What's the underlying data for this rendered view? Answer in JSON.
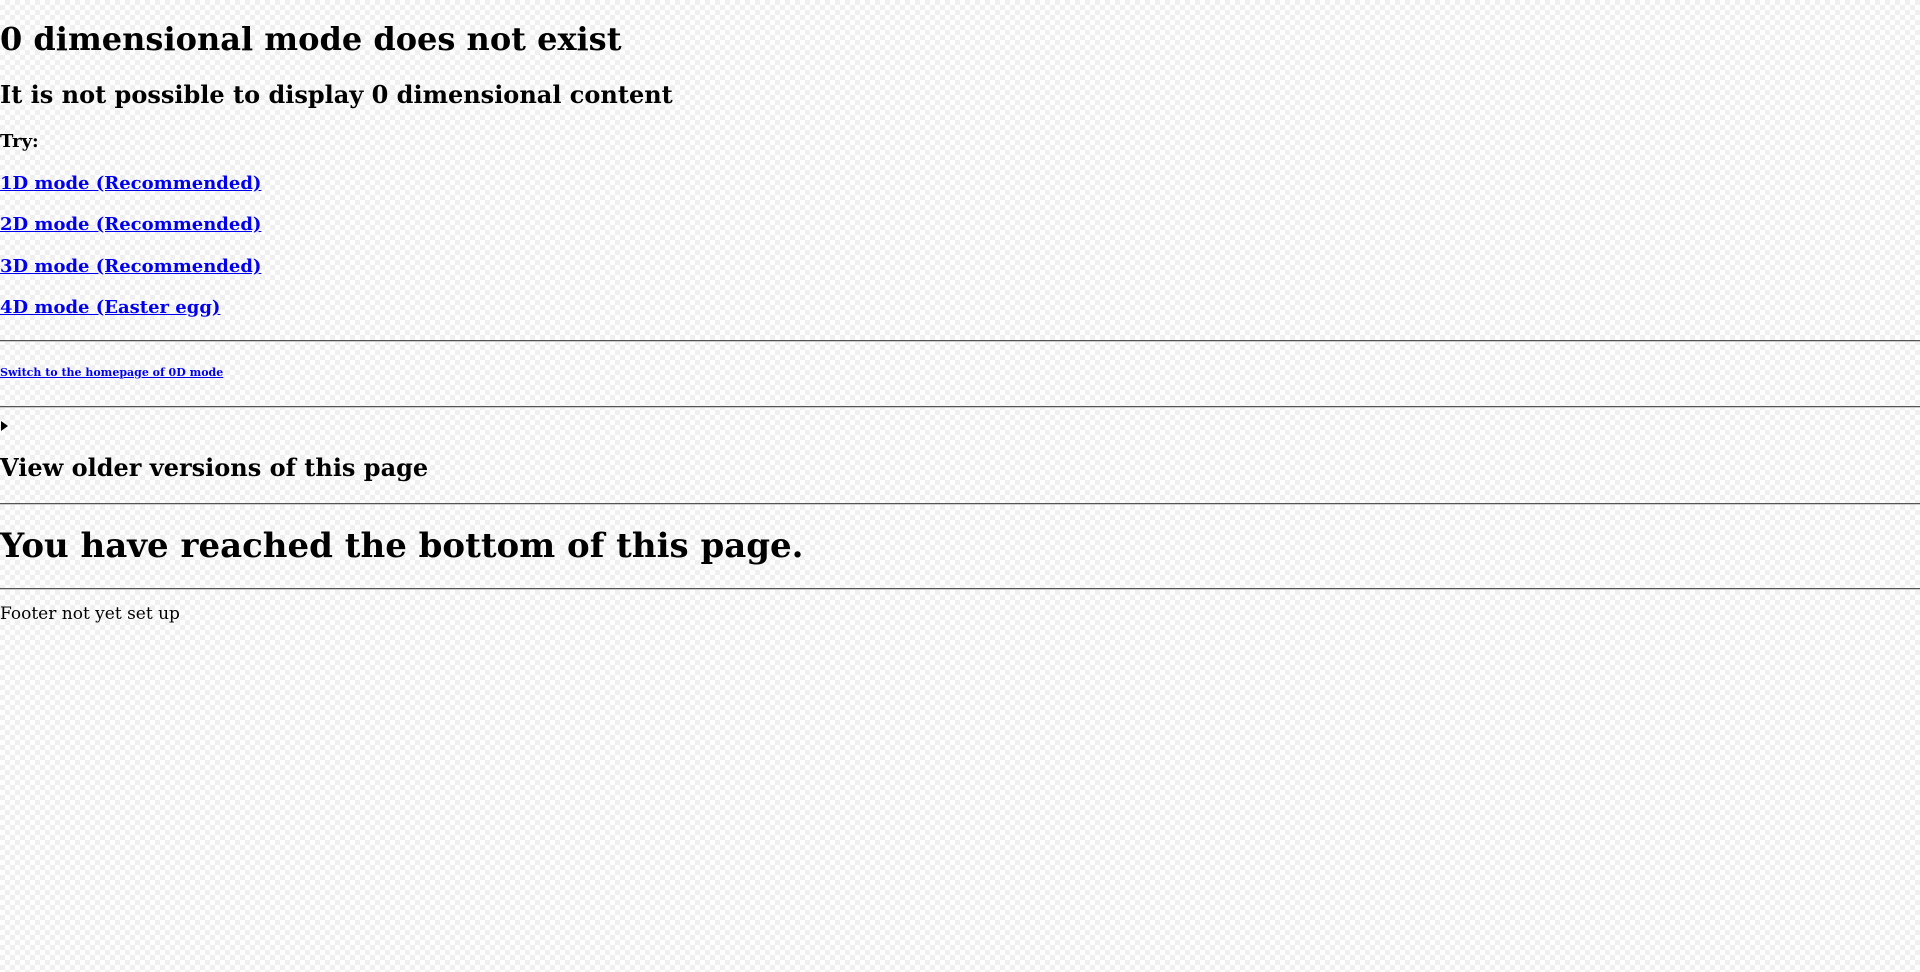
{
  "main": {
    "title": "0 dimensional mode does not exist",
    "subtitle": "It is not possible to display 0 dimensional content",
    "try_label": "Try:",
    "options": [
      {
        "label": "1D mode (Recommended)"
      },
      {
        "label": "2D mode (Recommended)"
      },
      {
        "label": "3D mode (Recommended)"
      },
      {
        "label": "4D mode (Easter egg)"
      }
    ],
    "home_link": "Switch to the homepage of 0D mode"
  },
  "versions": {
    "summary_icon": "disclosure-triangle-icon",
    "heading": "View older versions of this page"
  },
  "bottom": {
    "message": "You have reached the bottom of this page."
  },
  "footer": {
    "text": "Footer not yet set up"
  },
  "colors": {
    "link": "#0000ee",
    "text": "#000000"
  }
}
